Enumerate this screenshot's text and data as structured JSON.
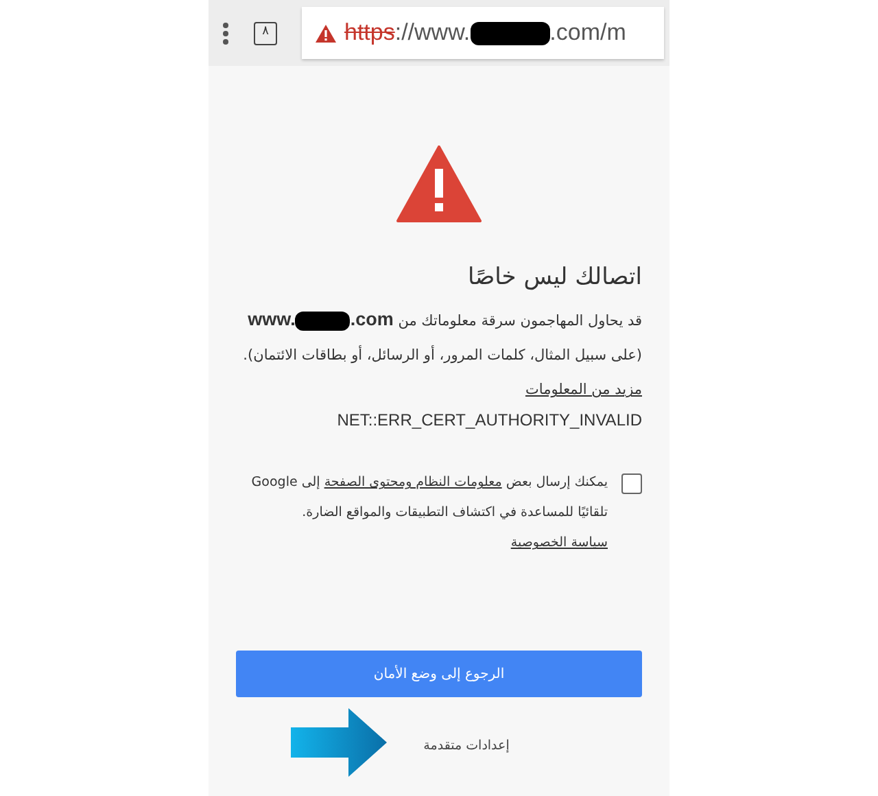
{
  "toolbar": {
    "tab_count": "٨",
    "url": {
      "scheme": "https",
      "host_start": "://www.",
      "host_end": ".com/m",
      "insecure": true
    }
  },
  "title": "اتصالك ليس خاصًا",
  "message": {
    "before": "قد يحاول المهاجمون سرقة معلوماتك من",
    "host_start": "www.",
    "host_end": ".com",
    "after": "(على سبيل المثال، كلمات المرور، أو الرسائل، أو بطاقات الائتمان).",
    "link": "مزيد من المعلومات"
  },
  "error_code": "NET::ERR_CERT_AUTHORITY_INVALID",
  "report": {
    "checked": false,
    "before": "يمكنك إرسال بعض",
    "link1": "معلومات النظام ومحتوى الصفحة",
    "middle": "إلى Google تلقائيًا للمساعدة في اكتشاف التطبيقات والمواقع الضارة.",
    "link2": "سياسة الخصوصية"
  },
  "primary_button": "الرجوع إلى وضع الأمان",
  "advanced_link": "إعدادات متقدمة"
}
